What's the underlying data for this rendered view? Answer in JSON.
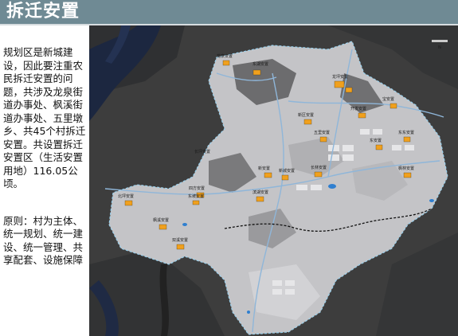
{
  "header": {
    "title": "拆迁安置"
  },
  "text": {
    "paragraph1": "规划区是新城建设，因此要注重农民拆迁安置的问题，共涉及龙泉街道办事处、枫溪街道办事处、五里墩乡、共45个村拆迁安置。共设置拆迁安置区（生活安置用地）116.05公顷。",
    "paragraph2": "原则：村为主体、统一规划、统一建设、统一管理、共享配套、设施保障"
  },
  "map": {
    "colors": {
      "background": "#3e3e3e",
      "planned_area": "#c9c9cc",
      "river": "#1e2a44",
      "resettlement": "#f0a01e",
      "road": "#8fb6d9",
      "boundary": "#9ad0ec"
    },
    "labels": [
      "龙泉安置",
      "东湖安置",
      "龙坪安置",
      "宝安置",
      "开发安置",
      "新区安置",
      "五里安置",
      "东东安置",
      "东安置",
      "长坪安置",
      "新安置",
      "新城安置",
      "长林安置",
      "枫林安置",
      "四方安置",
      "滨湖安置",
      "北坪安置",
      "东坡安置",
      "枫溪安置",
      "双溪安置"
    ]
  }
}
